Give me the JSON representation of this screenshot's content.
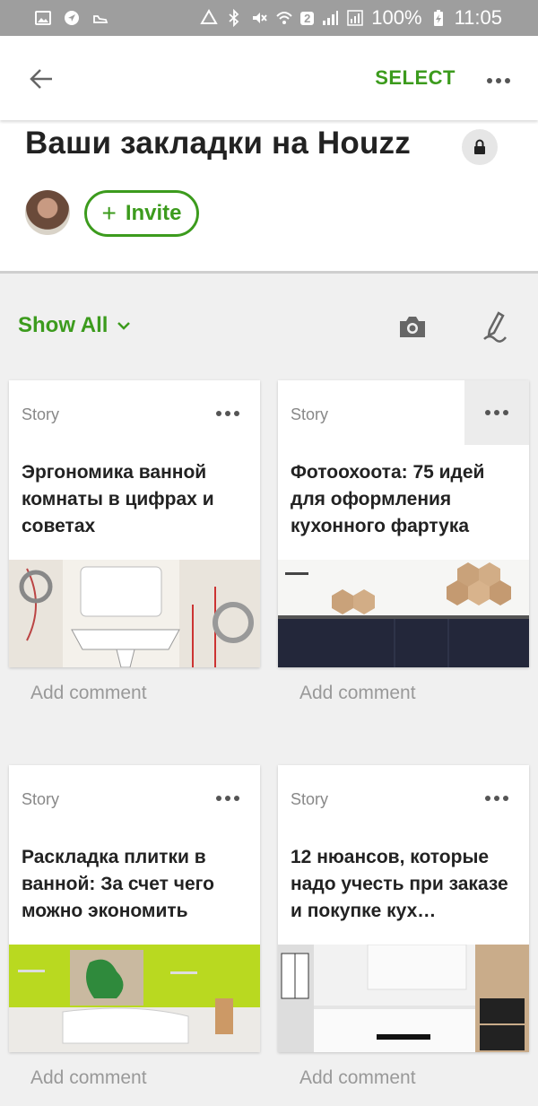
{
  "status_bar": {
    "battery": "100%",
    "time": "11:05",
    "sim": "2"
  },
  "appbar": {
    "select_label": "SELECT"
  },
  "header": {
    "title": "Ваши закладки на Houzz",
    "invite_label": "Invite"
  },
  "toolbar": {
    "filter_label": "Show All"
  },
  "cards": [
    {
      "type": "Story",
      "title": "Эргономика ванной комнаты в цифрах и советах",
      "comment_placeholder": "Add comment"
    },
    {
      "type": "Story",
      "title": "Фотоохоота: 75 идей для оформления кухонного фартука",
      "comment_placeholder": "Add comment"
    },
    {
      "type": "Story",
      "title": "Раскладка плитки в ванной: За счет чего можно экономить",
      "comment_placeholder": "Add comment"
    },
    {
      "type": "Story",
      "title": "12 нюансов, которые надо учесть при заказе и покупке кух…",
      "comment_placeholder": "Add comment"
    }
  ],
  "colors": {
    "accent": "#3c9b1d",
    "status_bar": "#9e9e9e",
    "background": "#f0f0f0"
  }
}
